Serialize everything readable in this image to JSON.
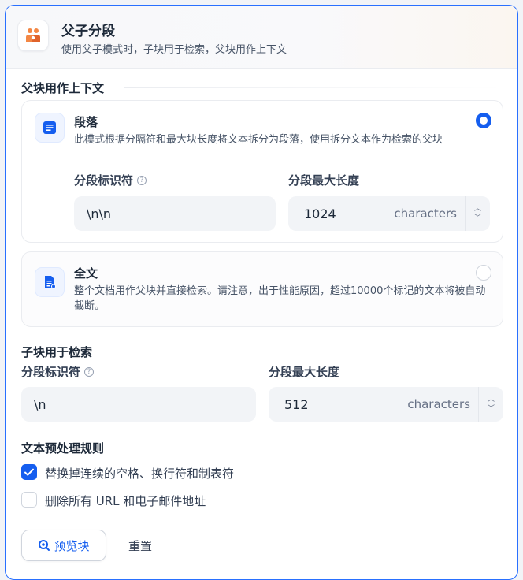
{
  "header": {
    "title": "父子分段",
    "description": "使用父子模式时，子块用于检索，父块用作上下文"
  },
  "parent_section": {
    "title": "父块用作上下文",
    "options": [
      {
        "title": "段落",
        "description": "此模式根据分隔符和最大块长度将文本拆分为段落，使用拆分文本作为检索的父块",
        "selected": true
      },
      {
        "title": "全文",
        "description": "整个文档用作父块并直接检索。请注意，出于性能原因，超过10000个标记的文本将被自动截断。",
        "selected": false
      }
    ],
    "delimiter_label": "分段标识符",
    "delimiter_value": "\\n\\n",
    "max_length_label": "分段最大长度",
    "max_length_value": "1024",
    "max_length_unit": "characters"
  },
  "child_section": {
    "title": "子块用于检索",
    "delimiter_label": "分段标识符",
    "delimiter_value": "\\n",
    "max_length_label": "分段最大长度",
    "max_length_value": "512",
    "max_length_unit": "characters"
  },
  "preprocess": {
    "title": "文本预处理规则",
    "rules": [
      {
        "label": "替换掉连续的空格、换行符和制表符",
        "checked": true
      },
      {
        "label": "删除所有 URL 和电子邮件地址",
        "checked": false
      }
    ]
  },
  "actions": {
    "preview_label": "预览块",
    "reset_label": "重置"
  },
  "colors": {
    "accent": "#155eef",
    "border_focus": "#2970ff",
    "input_bg": "#f2f4f7"
  }
}
